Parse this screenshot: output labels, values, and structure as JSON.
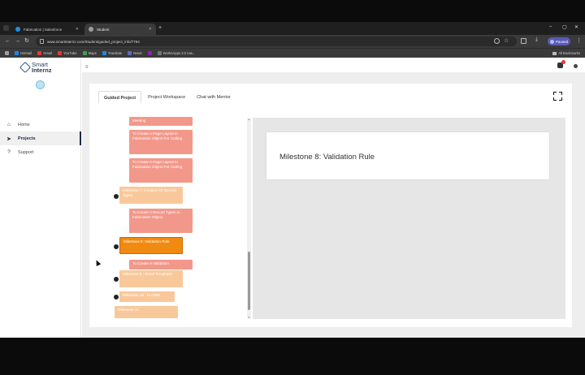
{
  "browser": {
    "tabs": [
      {
        "label": "Fabrication | Salesforce",
        "active": false
      },
      {
        "label": "Student",
        "active": true
      }
    ],
    "new_tab": "+",
    "url": "www.smartinternz.com/Student/guided_project_info/7794",
    "profile_label": "Paused",
    "bookmarks": [
      {
        "label": "Hotmail",
        "color": "#1e88e5"
      },
      {
        "label": "Gmail",
        "color": "#e53935"
      },
      {
        "label": "YouTube",
        "color": "#e53935"
      },
      {
        "label": "Maps",
        "color": "#43a047"
      },
      {
        "label": "Translate",
        "color": "#1e88e5"
      },
      {
        "label": "News",
        "color": "#5c6bc0"
      },
      {
        "label": "",
        "color": "#8e24aa"
      },
      {
        "label": "WorksApps 3.0 nas...",
        "color": "#757575"
      }
    ],
    "all_bookmarks": "All Bookmarks"
  },
  "app": {
    "logo_line1": "Smart",
    "logo_line2": "Internz",
    "nav": [
      {
        "label": "Home",
        "icon": "home-icon",
        "active": false
      },
      {
        "label": "Projects",
        "icon": "send-icon",
        "active": true
      },
      {
        "label": "Support",
        "icon": "help-icon",
        "active": false
      }
    ]
  },
  "main": {
    "tabs": [
      {
        "label": "Guided Project",
        "active": true
      },
      {
        "label": "Project Workspace",
        "active": false
      },
      {
        "label": "Chat with Mentor",
        "active": false
      }
    ],
    "tree_nodes": [
      {
        "label": "Meeting",
        "kind": "task"
      },
      {
        "label": "To Create A Page Layout In Fabrication Object For Cutting",
        "kind": "task"
      },
      {
        "label": "To Create A Page Layout In Fabrication Object For Cutting",
        "kind": "task"
      },
      {
        "label": "Milestone 7: Creation Of Record Types",
        "kind": "ms"
      },
      {
        "label": "To Create A Record Types In Fabrication Object",
        "kind": "task"
      },
      {
        "label": "Milestone 8: Validation Rule",
        "kind": "current"
      },
      {
        "label": "To Create A Validation",
        "kind": "task"
      },
      {
        "label": "Milestone 9 : Email Templates",
        "kind": "ms"
      },
      {
        "label": "Milestone 10 : FLOWS",
        "kind": "ms"
      },
      {
        "label": "Milestone 11",
        "kind": "ms"
      }
    ],
    "milestone_title": "Milestone 8: Validation Rule"
  }
}
